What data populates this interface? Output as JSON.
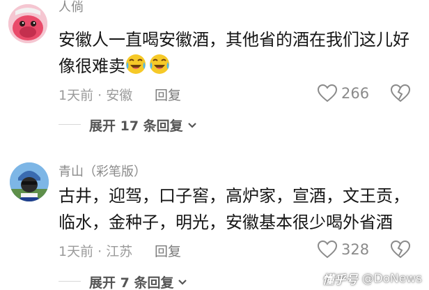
{
  "comments": [
    {
      "username": "人倘",
      "text": "安徽人一直喝安徽酒，其他省的酒在我们这儿好像很难卖",
      "emojis": [
        "laugh-cry-emoji",
        "laugh-cry-emoji"
      ],
      "meta": "1天前 · 安徽",
      "reply_label": "回复",
      "likes": "266",
      "expand_label": "展开 17 条回复"
    },
    {
      "username": "青山（彩笔版）",
      "text": "古井，迎驾，口子窖，高炉家，宣酒，文王贡，临水，金种子，明光，安徽基本很少喝外省酒",
      "meta": "1天前 · 江苏",
      "reply_label": "回复",
      "likes": "328",
      "expand_label": "展开 7 条回复"
    }
  ],
  "watermark": {
    "logo": "懂乎号",
    "handle": "@DoNews"
  },
  "colors": {
    "body_text": "#161616",
    "meta_text": "#9a9a9a",
    "emoji_face": "#f6c928"
  },
  "icons": [
    "heart-outline-icon",
    "broken-heart-icon",
    "chevron-down-icon"
  ]
}
